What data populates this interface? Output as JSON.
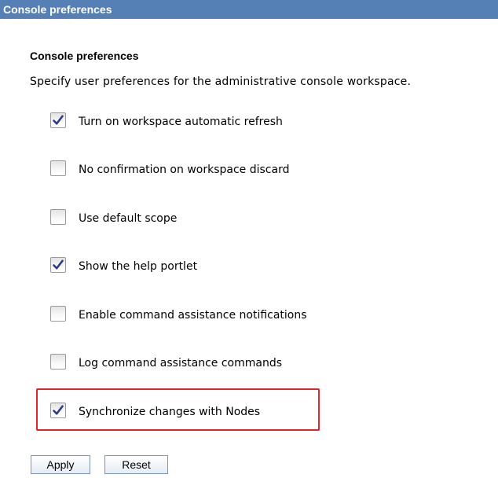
{
  "window": {
    "title": "Console preferences"
  },
  "section": {
    "heading": "Console preferences",
    "description": "Specify user preferences for the administrative console workspace."
  },
  "preferences": [
    {
      "label": "Turn on workspace automatic refresh",
      "checked": true
    },
    {
      "label": "No confirmation on workspace discard",
      "checked": false
    },
    {
      "label": "Use default scope",
      "checked": false
    },
    {
      "label": "Show the help portlet",
      "checked": true
    },
    {
      "label": "Enable command assistance notifications",
      "checked": false
    },
    {
      "label": "Log command assistance commands",
      "checked": false
    },
    {
      "label": "Synchronize changes with Nodes",
      "checked": true,
      "highlighted": true
    }
  ],
  "buttons": {
    "apply_label": "Apply",
    "reset_label": "Reset"
  },
  "colors": {
    "title_bar": "#5580b6",
    "highlight_border": "#e0242b",
    "checkmark": "#2c3e86"
  },
  "icons": {
    "checkbox_checked": "check-icon"
  }
}
